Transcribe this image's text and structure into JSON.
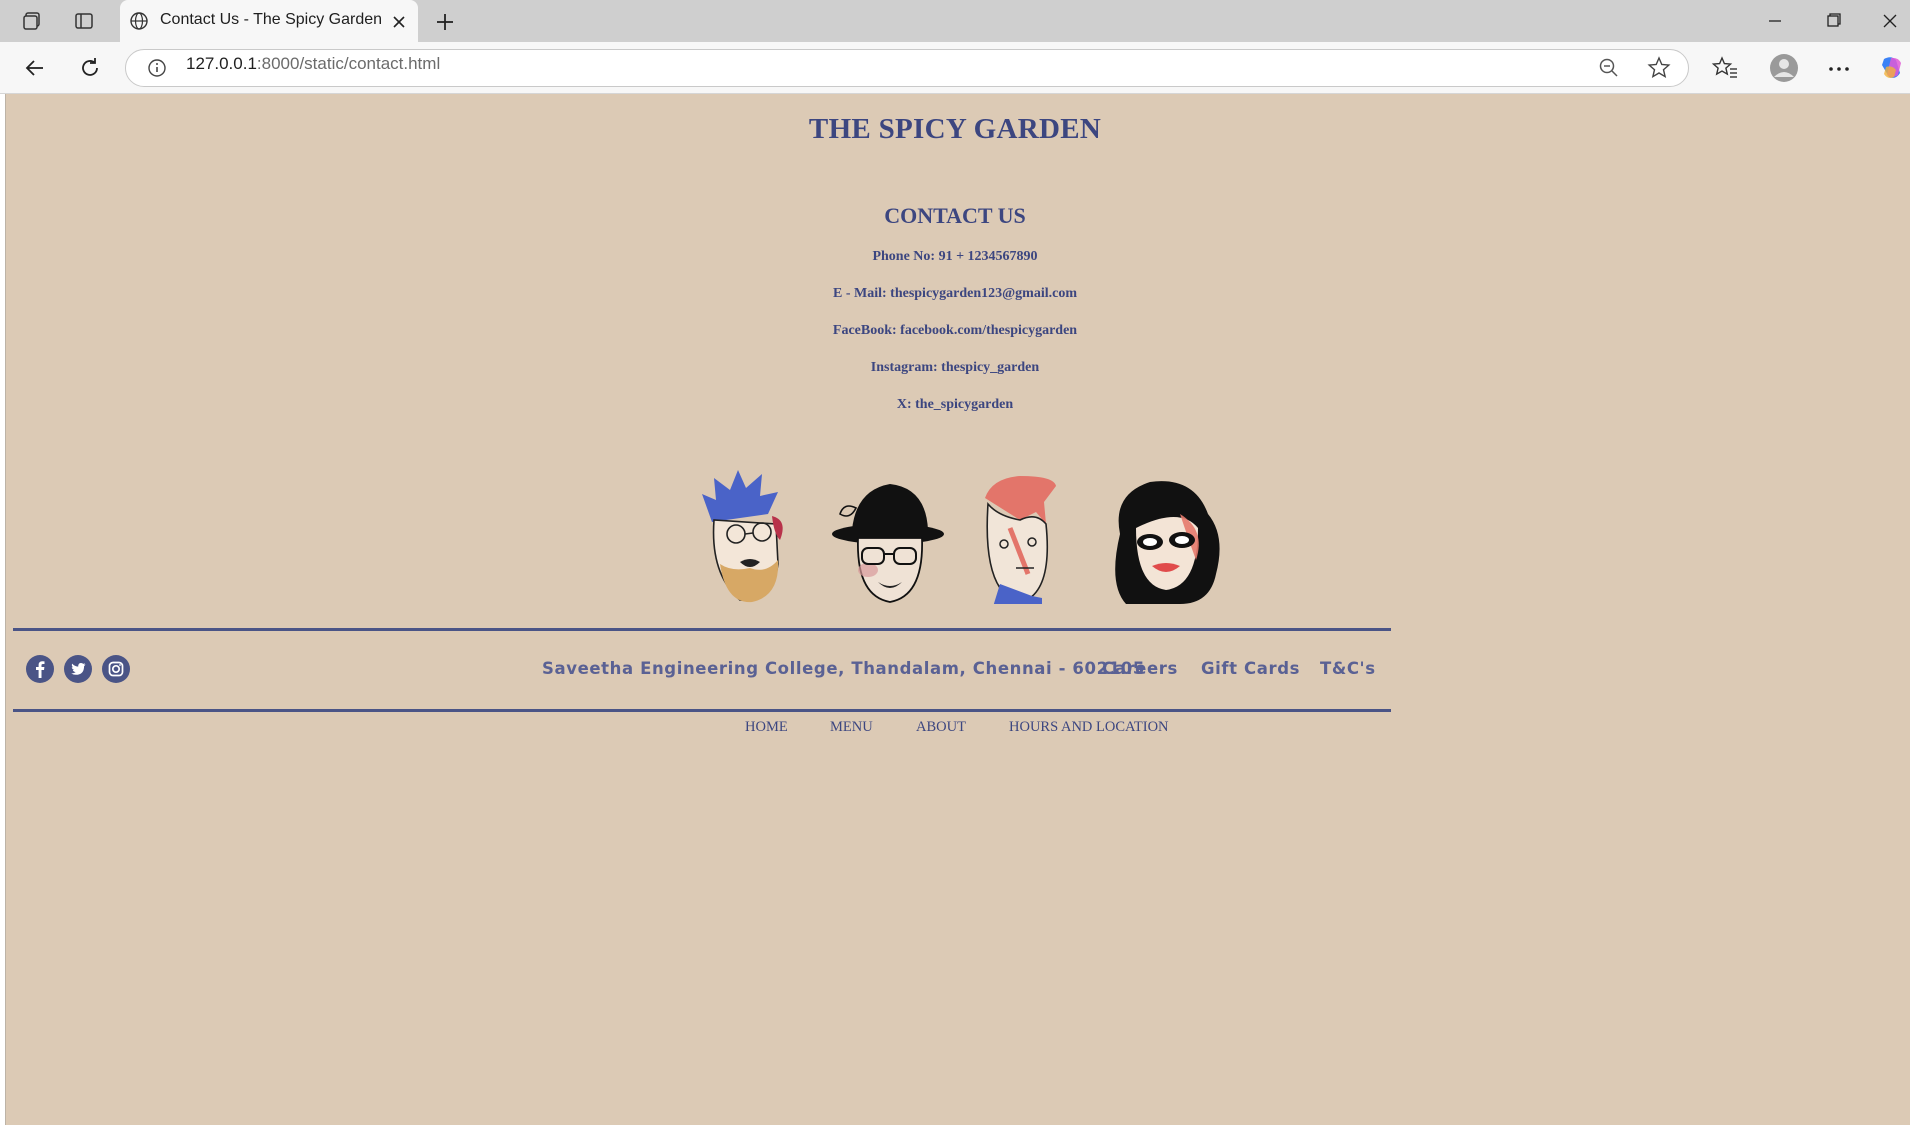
{
  "browser": {
    "tab_title": "Contact Us - The Spicy Garden",
    "url_host": "127.0.0.1",
    "url_path": ":8000/static/contact.html"
  },
  "page": {
    "site_title": "THE SPICY GARDEN",
    "heading": "CONTACT US",
    "contacts": [
      "Phone No: 91 + 1234567890",
      "E - Mail: thespicygarden123@gmail.com",
      "FaceBook: facebook.com/thespicygarden",
      "Instagram: thespicy_garden",
      "X: the_spicygarden"
    ],
    "illustration": [
      "face-blue-hair-icon",
      "face-hat-glasses-icon",
      "face-coral-hair-icon",
      "face-sunglasses-curly-icon"
    ]
  },
  "footer": {
    "social": [
      "facebook-icon",
      "twitter-icon",
      "instagram-icon"
    ],
    "address": "Saveetha Engineering College, Thandalam, Chennai - 602105",
    "links": [
      "Careers",
      "Gift Cards",
      "T&C's"
    ]
  },
  "nav": [
    "HOME",
    "MENU",
    "ABOUT",
    "HOURS AND LOCATION"
  ],
  "colors": {
    "background": "#dccab5",
    "accent": "#3c4680"
  }
}
